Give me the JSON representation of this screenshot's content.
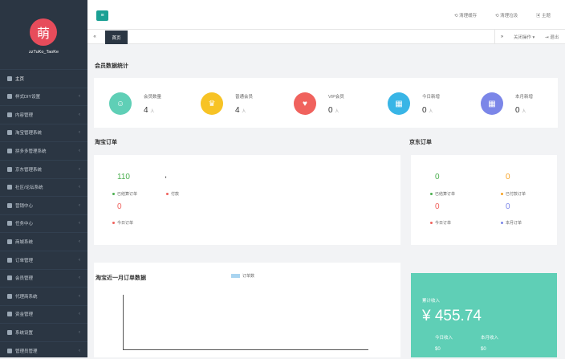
{
  "sidebar": {
    "avatar_char": "萌",
    "username": "zzTuKo_TaoKe",
    "items": [
      {
        "label": "主页",
        "icon": "home-icon"
      },
      {
        "label": "样式DIY设置",
        "icon": "palette-icon"
      },
      {
        "label": "内容管理",
        "icon": "document-icon"
      },
      {
        "label": "淘宝管理系统",
        "icon": "chart-icon"
      },
      {
        "label": "拼多多管理系统",
        "icon": "chart-icon"
      },
      {
        "label": "京东管理系统",
        "icon": "chart-icon"
      },
      {
        "label": "社区/论坛系统",
        "icon": "community-icon"
      },
      {
        "label": "营销中心",
        "icon": "marketing-icon"
      },
      {
        "label": "任务中心",
        "icon": "task-icon"
      },
      {
        "label": "商城系统",
        "icon": "shop-icon"
      },
      {
        "label": "订单管理",
        "icon": "order-icon"
      },
      {
        "label": "会员管理",
        "icon": "user-icon"
      },
      {
        "label": "代理商系统",
        "icon": "agent-icon"
      },
      {
        "label": "资金管理",
        "icon": "money-icon"
      },
      {
        "label": "系统设置",
        "icon": "gear-icon"
      },
      {
        "label": "管理员管理",
        "icon": "admin-icon"
      }
    ]
  },
  "topbar": {
    "clear_cache": "清理缓存",
    "clear_data": "清理垃圾",
    "theme": "主题"
  },
  "tabs": {
    "prev": "«",
    "home": "首页",
    "next": "»",
    "close_ops": "关闭操作",
    "exit": "退出"
  },
  "member_stats": {
    "title": "会员数据统计",
    "items": [
      {
        "label": "会员数量",
        "value": "4",
        "unit": "人",
        "color": "#5fcfb6"
      },
      {
        "label": "普通会员",
        "value": "4",
        "unit": "人",
        "color": "#f7c325"
      },
      {
        "label": "VIP会员",
        "value": "0",
        "unit": "人",
        "color": "#f0625d"
      },
      {
        "label": "今日新增",
        "value": "0",
        "unit": "人",
        "color": "#38b5e6"
      },
      {
        "label": "本月新增",
        "value": "0",
        "unit": "人",
        "color": "#7b86e8"
      }
    ]
  },
  "taobao_orders": {
    "title": "淘宝订单",
    "settled_value": "110",
    "settled_label": "已结算订单",
    "paid_label": "付款",
    "today_value": "0",
    "today_label": "今日订单"
  },
  "jd_orders": {
    "title": "京东订单",
    "settled_value": "0",
    "settled_label": "已结算订单",
    "paid_value": "0",
    "paid_label": "已付款订单",
    "today_value": "0",
    "today_label": "今日订单",
    "month_value": "0",
    "month_label": "本月订单"
  },
  "taobao_month": {
    "title": "淘宝近一月订单数据",
    "legend": "订单数"
  },
  "income": {
    "title": "累计收入",
    "total": "¥ 455.74",
    "today_label": "今日收入",
    "today_value": "$0",
    "month_label": "本月收入",
    "month_value": "$0"
  },
  "colors": {
    "sidebar_bg": "#2b3643",
    "accent": "#1aa094",
    "green": "#5fcfb6",
    "red": "#f0625d",
    "orange": "#f7a325",
    "blue": "#7b86e8"
  }
}
